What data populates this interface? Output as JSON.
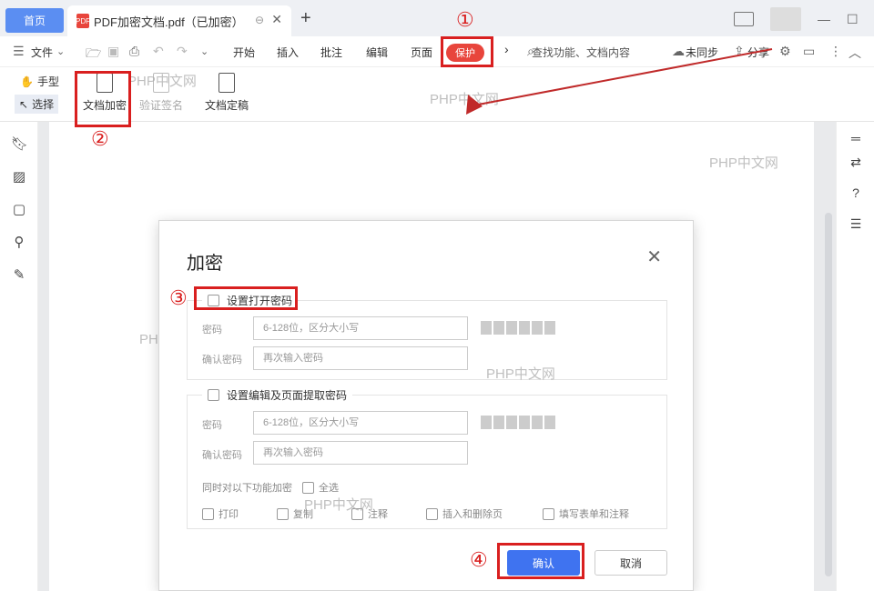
{
  "titlebar": {
    "home_tab": "首页",
    "doc_tab": "PDF加密文档.pdf（已加密）",
    "pdf_badge": "PDF",
    "new_tab_symbol": "+",
    "pin_symbol": "⊖",
    "close_symbol": "✕",
    "minimize": "—",
    "maximize": "☐",
    "close_window": "✕"
  },
  "menubar": {
    "file": "文件",
    "items": [
      "开始",
      "插入",
      "批注",
      "编辑",
      "页面"
    ],
    "active_tab": "保护",
    "more": "›",
    "search_placeholder": "查找功能、文档内容",
    "sync": "未同步",
    "share": "分享"
  },
  "ribbon": {
    "hand": "手型",
    "select": "选择",
    "encrypt": "文档加密",
    "verify_sign": "验证签名",
    "finalize": "文档定稿"
  },
  "dialog": {
    "title": "加密",
    "open_pw_section": "设置打开密码",
    "edit_pw_section": "设置编辑及页面提取密码",
    "password_label": "密码",
    "confirm_label": "确认密码",
    "password_placeholder": "6-128位，区分大小写",
    "confirm_placeholder": "再次输入密码",
    "encrypt_functions_label": "同时对以下功能加密",
    "select_all": "全选",
    "options": [
      "打印",
      "复制",
      "注释",
      "插入和删除页",
      "填写表单和注释"
    ],
    "ok": "确认",
    "cancel": "取消"
  },
  "annotations": {
    "steps": [
      "①",
      "②",
      "③",
      "④"
    ],
    "color": "#d91f1f"
  },
  "watermark": "PHP中文网",
  "colors": {
    "accent": "#3f73f0",
    "protect_tab": "#e8453c",
    "home_tab": "#5b8ef2"
  }
}
